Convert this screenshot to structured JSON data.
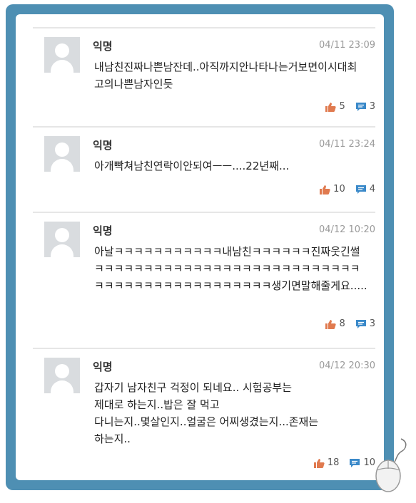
{
  "comments": [
    {
      "author": "익명",
      "time": "04/11 23:09",
      "text": "내남친진짜나쁜남잔데..아직까지안나타나는거보면이시대최고의나쁜남자인듯",
      "likes": "5",
      "replies": "3"
    },
    {
      "author": "익명",
      "time": "04/11 23:24",
      "text": "아개빡쳐남친연락이안되여ㅡㅡ....22년째...",
      "likes": "10",
      "replies": "4"
    },
    {
      "author": "익명",
      "time": "04/12 10:20",
      "text": "아날ㅋㅋㅋㅋㅋㅋㅋㅋㅋㅋㅋ내남친ㅋㅋㅋㅋㅋㅋ진짜웃긴썰ㅋㅋㅋㅋㅋㅋㅋㅋㅋㅋㅋㅋㅋㅋㅋㅋㅋㅋㅋㅋㅋㅋㅋㅋㅋㅋㅋㅋㅋㅋㅋㅋㅋㅋㅋㅋㅋㅋㅋㅋㅋㅋㅋㅋㅋ생기면말해줄게요.....",
      "likes": "8",
      "replies": "3"
    },
    {
      "author": "익명",
      "time": "04/12 20:30",
      "text_lines": [
        "갑자기 남자친구 걱정이 되네요.. 시험공부는",
        "제대로 하는지..밥은 잘 먹고",
        "다니는지..몇살인지..얼굴은 어찌생겼는지...존재는",
        "하는지.."
      ],
      "likes": "18",
      "replies": "10"
    }
  ],
  "colors": {
    "frame": "#4e8fb3",
    "like": "#e07a4f",
    "reply": "#3a89c9"
  },
  "icons": {
    "like": "thumbs-up-icon",
    "reply": "speech-bubble-icon",
    "avatar": "default-avatar-icon"
  }
}
